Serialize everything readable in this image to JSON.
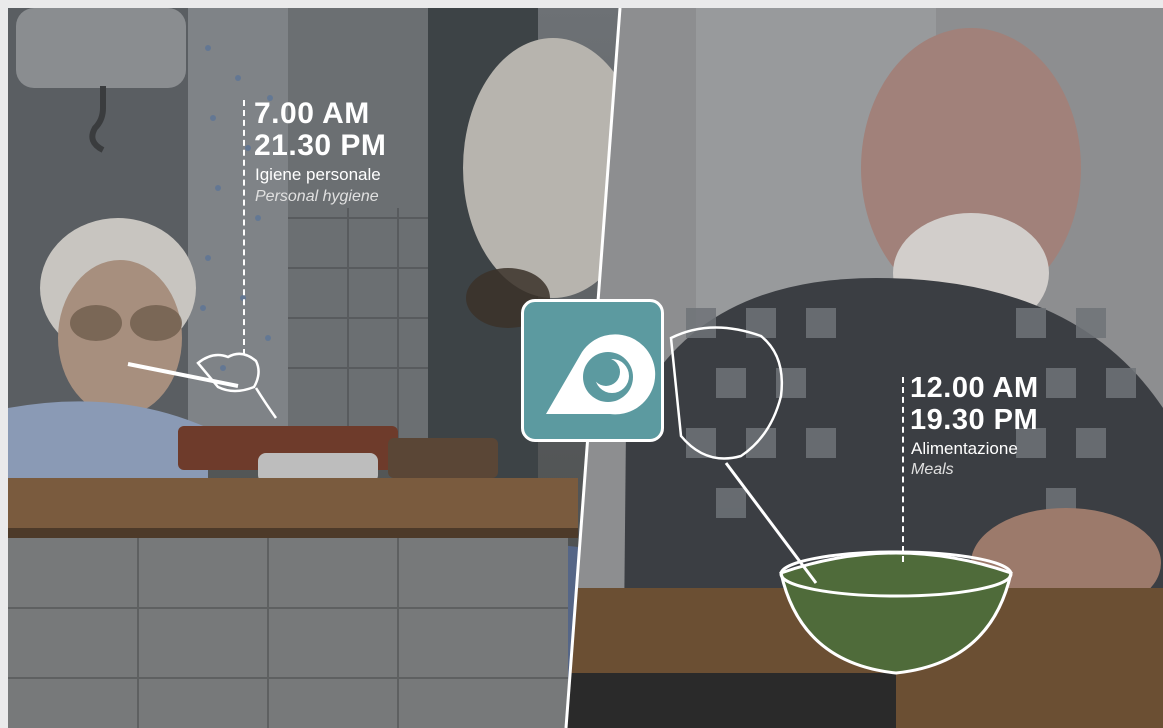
{
  "left": {
    "time_1": "7.00 AM",
    "time_2": "21.30 PM",
    "label_it": "Igiene personale",
    "label_en": "Personal hygiene"
  },
  "right": {
    "time_1": "12.00 AM",
    "time_2": "19.30 PM",
    "label_it": "Alimentazione",
    "label_en": "Meals"
  },
  "logo": {
    "icon": "d-moon-logo-icon",
    "color": "#5c9aa0"
  }
}
